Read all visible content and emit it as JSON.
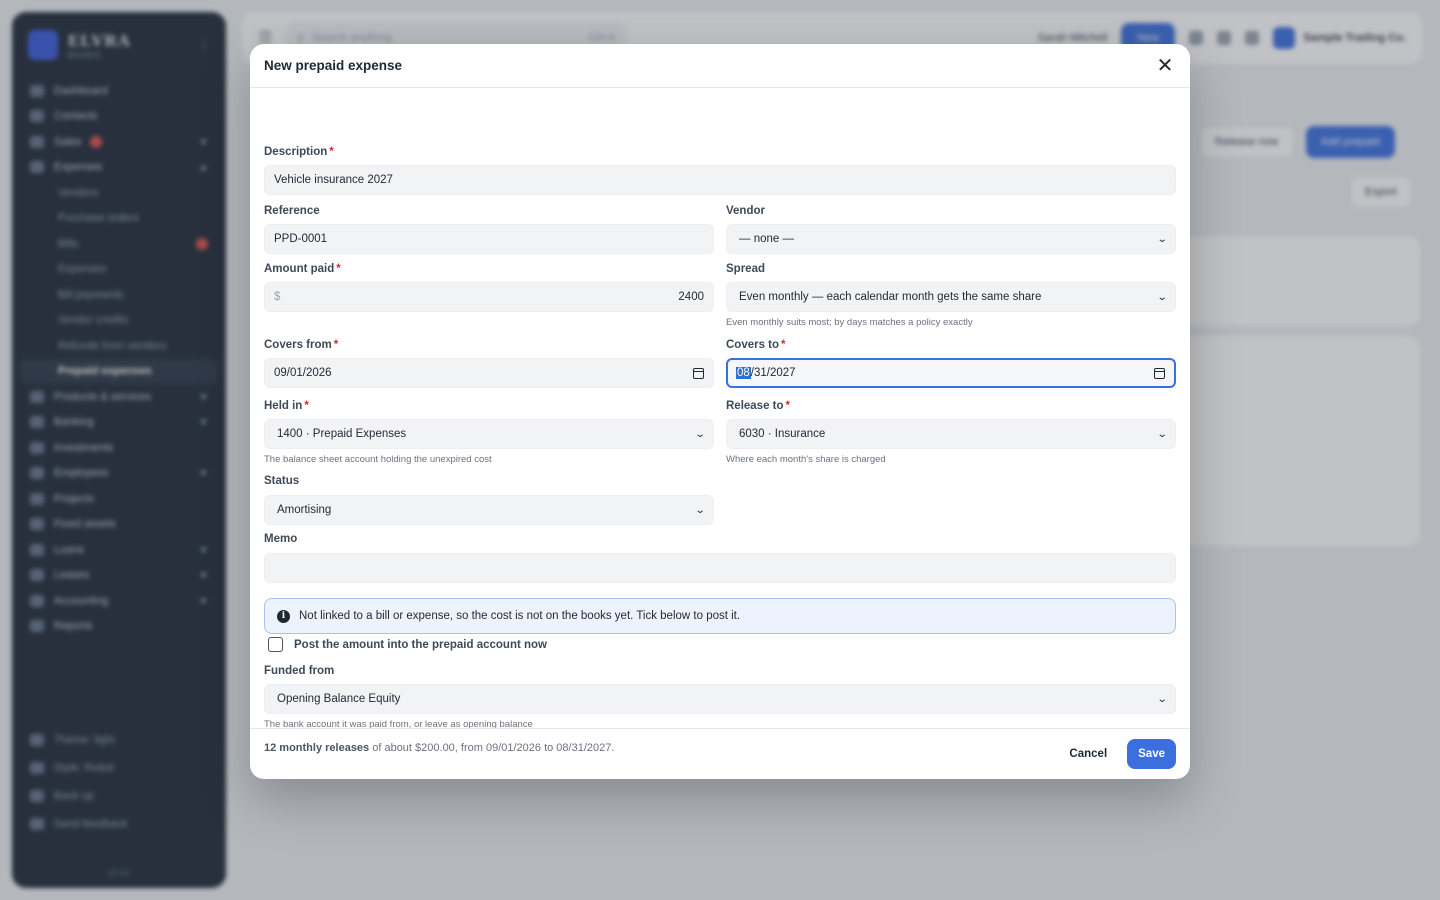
{
  "background": {
    "brand": {
      "name": "ELVRA",
      "sub": "BOOKS"
    },
    "sidebar": {
      "items": [
        {
          "label": "Dashboard"
        },
        {
          "label": "Contacts"
        },
        {
          "label": "Sales"
        },
        {
          "label": "Expenses"
        },
        {
          "label": "Vendors"
        },
        {
          "label": "Purchase orders"
        },
        {
          "label": "Bills"
        },
        {
          "label": "Expenses"
        },
        {
          "label": "Bill payments"
        },
        {
          "label": "Vendor credits"
        },
        {
          "label": "Refunds from vendors"
        },
        {
          "label": "Prepaid expenses"
        },
        {
          "label": "Products & services"
        },
        {
          "label": "Banking"
        },
        {
          "label": "Investments"
        },
        {
          "label": "Employees"
        },
        {
          "label": "Projects"
        },
        {
          "label": "Fixed assets"
        },
        {
          "label": "Loans"
        },
        {
          "label": "Leases"
        },
        {
          "label": "Accounting"
        },
        {
          "label": "Reports"
        }
      ],
      "bottom": [
        {
          "label": "Theme: light"
        },
        {
          "label": "Style: Ruled"
        },
        {
          "label": "Back up"
        },
        {
          "label": "Send feedback"
        }
      ],
      "version": "v0.41"
    },
    "topbar": {
      "search_placeholder": "Search anything",
      "search_hint": "Ctrl K",
      "user": "Sarah Mitchell",
      "new_label": "New",
      "company": "Sample Trading Co."
    },
    "actions": {
      "release_now": "Release now",
      "add_prepaid": "Add prepaid",
      "export": "Export"
    }
  },
  "dialog": {
    "title": "New prepaid expense",
    "fields": {
      "description": {
        "label": "Description",
        "value": "Vehicle insurance 2027"
      },
      "reference": {
        "label": "Reference",
        "value": "PPD-0001"
      },
      "vendor": {
        "label": "Vendor",
        "value": "— none —"
      },
      "amount": {
        "label": "Amount paid",
        "currency": "$",
        "value": "2400"
      },
      "spread": {
        "label": "Spread",
        "value": "Even monthly — each calendar month gets the same share",
        "help": "Even monthly suits most; by days matches a policy exactly"
      },
      "covers_from": {
        "label": "Covers from",
        "value": "09/01/2026"
      },
      "covers_to": {
        "label": "Covers to",
        "month": "08",
        "rest": "/31/2027"
      },
      "held_in": {
        "label": "Held in",
        "value": "1400 · Prepaid Expenses",
        "help": "The balance sheet account holding the unexpired cost"
      },
      "release_to": {
        "label": "Release to",
        "value": "6030 · Insurance",
        "help": "Where each month's share is charged"
      },
      "status": {
        "label": "Status",
        "value": "Amortising"
      },
      "memo": {
        "label": "Memo",
        "value": ""
      }
    },
    "info": "Not linked to a bill or expense, so the cost is not on the books yet. Tick below to post it.",
    "post_checkbox": {
      "label": "Post the amount into the prepaid account now",
      "checked": false
    },
    "funded_from": {
      "label": "Funded from",
      "value": "Opening Balance Equity",
      "help": "The bank account it was paid from, or leave as opening balance"
    },
    "summary": {
      "bold": "12 monthly releases",
      "rest": " of about $200.00, from 09/01/2026 to 08/31/2027."
    },
    "buttons": {
      "cancel": "Cancel",
      "save": "Save"
    }
  }
}
